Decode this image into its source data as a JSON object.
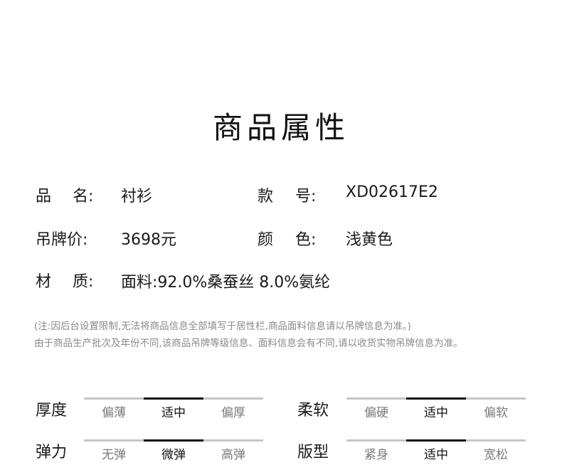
{
  "title": "商品属性",
  "attributes": {
    "name": {
      "label_1": "品",
      "label_2": "名:",
      "value": "衬衫"
    },
    "style_no": {
      "label_1": "款",
      "label_2": "号:",
      "value": "XD02617E2"
    },
    "tag_price": {
      "label": "吊牌价:",
      "value": "3698元"
    },
    "color": {
      "label_1": "颜",
      "label_2": "色:",
      "value": "浅黄色"
    },
    "material": {
      "label_1": "材",
      "label_2": "质:",
      "value": "面料:92.0%桑蚕丝 8.0%氨纶"
    }
  },
  "notes": {
    "line1": "(注:因后台设置限制,无法将商品信息全部填写于居性栏,商品面料信息请以吊牌信息为准。)",
    "line2": "由于商品生产批次及年份不同,该商品吊牌等级信息、面料信息会有不同,请以收货实物吊牌信息为准。"
  },
  "scales": {
    "thickness": {
      "label": "厚度",
      "options": [
        "偏薄",
        "适中",
        "偏厚"
      ],
      "selected": 1
    },
    "softness": {
      "label": "柔软",
      "options": [
        "偏硬",
        "适中",
        "偏软"
      ],
      "selected": 1
    },
    "elasticity": {
      "label": "弹力",
      "options": [
        "无弹",
        "微弹",
        "高弹"
      ],
      "selected": 1
    },
    "fit": {
      "label": "版型",
      "options": [
        "紧身",
        "适中",
        "宽松"
      ],
      "selected": 1
    }
  }
}
